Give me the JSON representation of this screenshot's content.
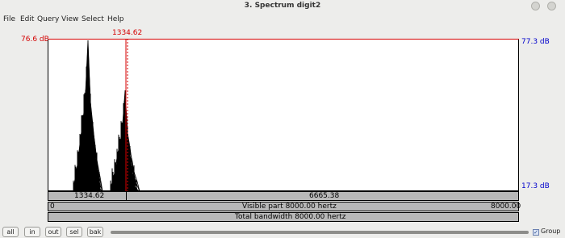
{
  "window": {
    "title": "3. Spectrum digit2"
  },
  "menu": [
    "File",
    "Edit",
    "Query",
    "View",
    "Select",
    "Help"
  ],
  "plot": {
    "cursor_freq_label": "1334.62",
    "left_top_db": "76.6 dB",
    "right_top_db": "77.3 dB",
    "right_bottom_db": "17.3 dB",
    "colors": {
      "cursor": "#d40000",
      "axis_right": "#0000cc",
      "spectrum": "#000000"
    }
  },
  "bars": {
    "row1_left": "1334.62",
    "row1_right": "6665.38",
    "row2_left": "0",
    "row2_center": "Visible part 8000.00 hertz",
    "row2_right": "8000.00",
    "row3_center": "Total bandwidth 8000.00 hertz"
  },
  "buttons": {
    "all": "all",
    "in": "in",
    "out": "out",
    "sel": "sel",
    "bak": "bak"
  },
  "group": {
    "label": "Group",
    "checked": true
  }
}
